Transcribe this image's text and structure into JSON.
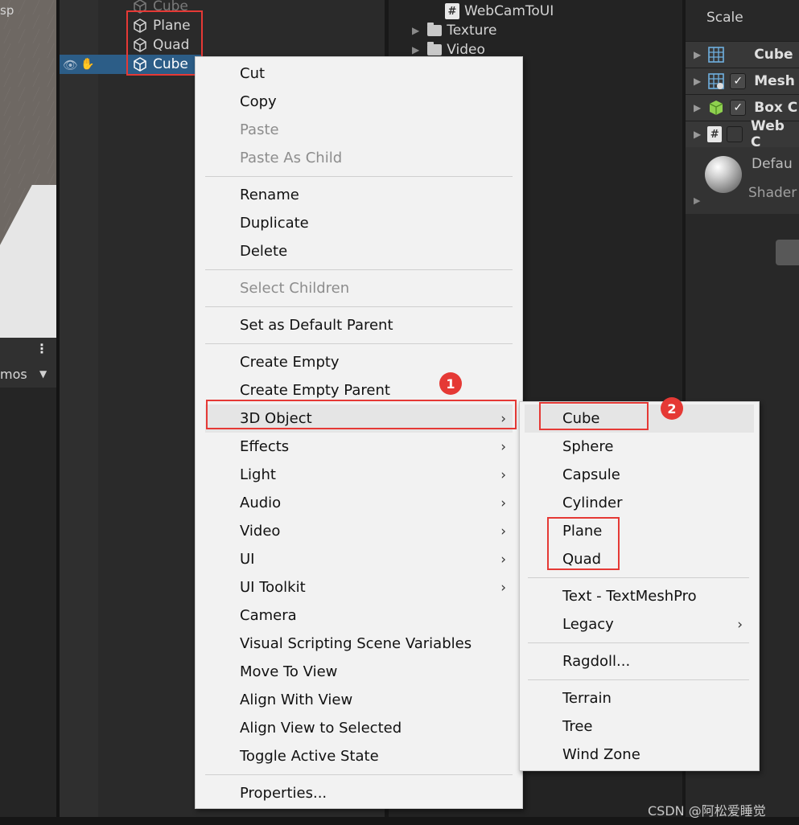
{
  "scene": {
    "title_fragment": "sp",
    "gizmos_fragment": "mos",
    "menu_icon": "vertical-dots-icon",
    "dropdown_icon": "caret-down-icon"
  },
  "hierarchy": {
    "items": [
      {
        "label": "Cube",
        "icon": "cube-icon",
        "state": "faded"
      },
      {
        "label": "Plane",
        "icon": "cube-icon",
        "state": "normal"
      },
      {
        "label": "Quad",
        "icon": "cube-icon",
        "state": "normal"
      },
      {
        "label": "Cube",
        "icon": "cube-icon",
        "state": "selected"
      }
    ]
  },
  "project": {
    "items": [
      {
        "label": "WebCamToUI",
        "icon": "csharp-script-icon"
      },
      {
        "label": "Texture",
        "icon": "folder-icon"
      },
      {
        "label": "Video",
        "icon": "folder-icon"
      }
    ]
  },
  "inspector": {
    "scale_label": "Scale",
    "components": [
      {
        "label": "Cube",
        "icon": "mesh-filter-icon",
        "checkbox": null
      },
      {
        "label": "Mesh",
        "icon": "mesh-renderer-icon",
        "checkbox": true
      },
      {
        "label": "Box C",
        "icon": "box-collider-icon",
        "checkbox": true
      },
      {
        "label": "Web C",
        "icon": "csharp-script-icon",
        "checkbox": false
      }
    ],
    "material": {
      "name": "Defau",
      "shader_label": "Shader"
    }
  },
  "context_menu": {
    "items": [
      {
        "label": "Cut",
        "disabled": false
      },
      {
        "label": "Copy",
        "disabled": false
      },
      {
        "label": "Paste",
        "disabled": true
      },
      {
        "label": "Paste As Child",
        "disabled": true
      },
      {
        "label": "Rename",
        "disabled": false
      },
      {
        "label": "Duplicate",
        "disabled": false
      },
      {
        "label": "Delete",
        "disabled": false
      },
      {
        "label": "Select Children",
        "disabled": true
      },
      {
        "label": "Set as Default Parent",
        "disabled": false
      },
      {
        "label": "Create Empty",
        "disabled": false
      },
      {
        "label": "Create Empty Parent",
        "disabled": false
      },
      {
        "label": "3D Object",
        "disabled": false,
        "submenu": true,
        "highlighted": true
      },
      {
        "label": "Effects",
        "disabled": false,
        "submenu": true
      },
      {
        "label": "Light",
        "disabled": false,
        "submenu": true
      },
      {
        "label": "Audio",
        "disabled": false,
        "submenu": true
      },
      {
        "label": "Video",
        "disabled": false,
        "submenu": true
      },
      {
        "label": "UI",
        "disabled": false,
        "submenu": true
      },
      {
        "label": "UI Toolkit",
        "disabled": false,
        "submenu": true
      },
      {
        "label": "Camera",
        "disabled": false
      },
      {
        "label": "Visual Scripting Scene Variables",
        "disabled": false
      },
      {
        "label": "Move To View",
        "disabled": false
      },
      {
        "label": "Align With View",
        "disabled": false
      },
      {
        "label": "Align View to Selected",
        "disabled": false
      },
      {
        "label": "Toggle Active State",
        "disabled": false
      },
      {
        "label": "Properties...",
        "disabled": false
      }
    ],
    "submenu_arrow": "›"
  },
  "submenu_3d": {
    "items": [
      {
        "label": "Cube",
        "highlighted": true
      },
      {
        "label": "Sphere"
      },
      {
        "label": "Capsule"
      },
      {
        "label": "Cylinder"
      },
      {
        "label": "Plane"
      },
      {
        "label": "Quad"
      },
      {
        "label": "Text - TextMeshPro"
      },
      {
        "label": "Legacy",
        "submenu": true
      },
      {
        "label": "Ragdoll..."
      },
      {
        "label": "Terrain"
      },
      {
        "label": "Tree"
      },
      {
        "label": "Wind Zone"
      }
    ]
  },
  "annotations": {
    "step1": "1",
    "step2": "2",
    "highlight_color": "#e53935"
  },
  "watermark": "CSDN @阿松爱睡觉"
}
